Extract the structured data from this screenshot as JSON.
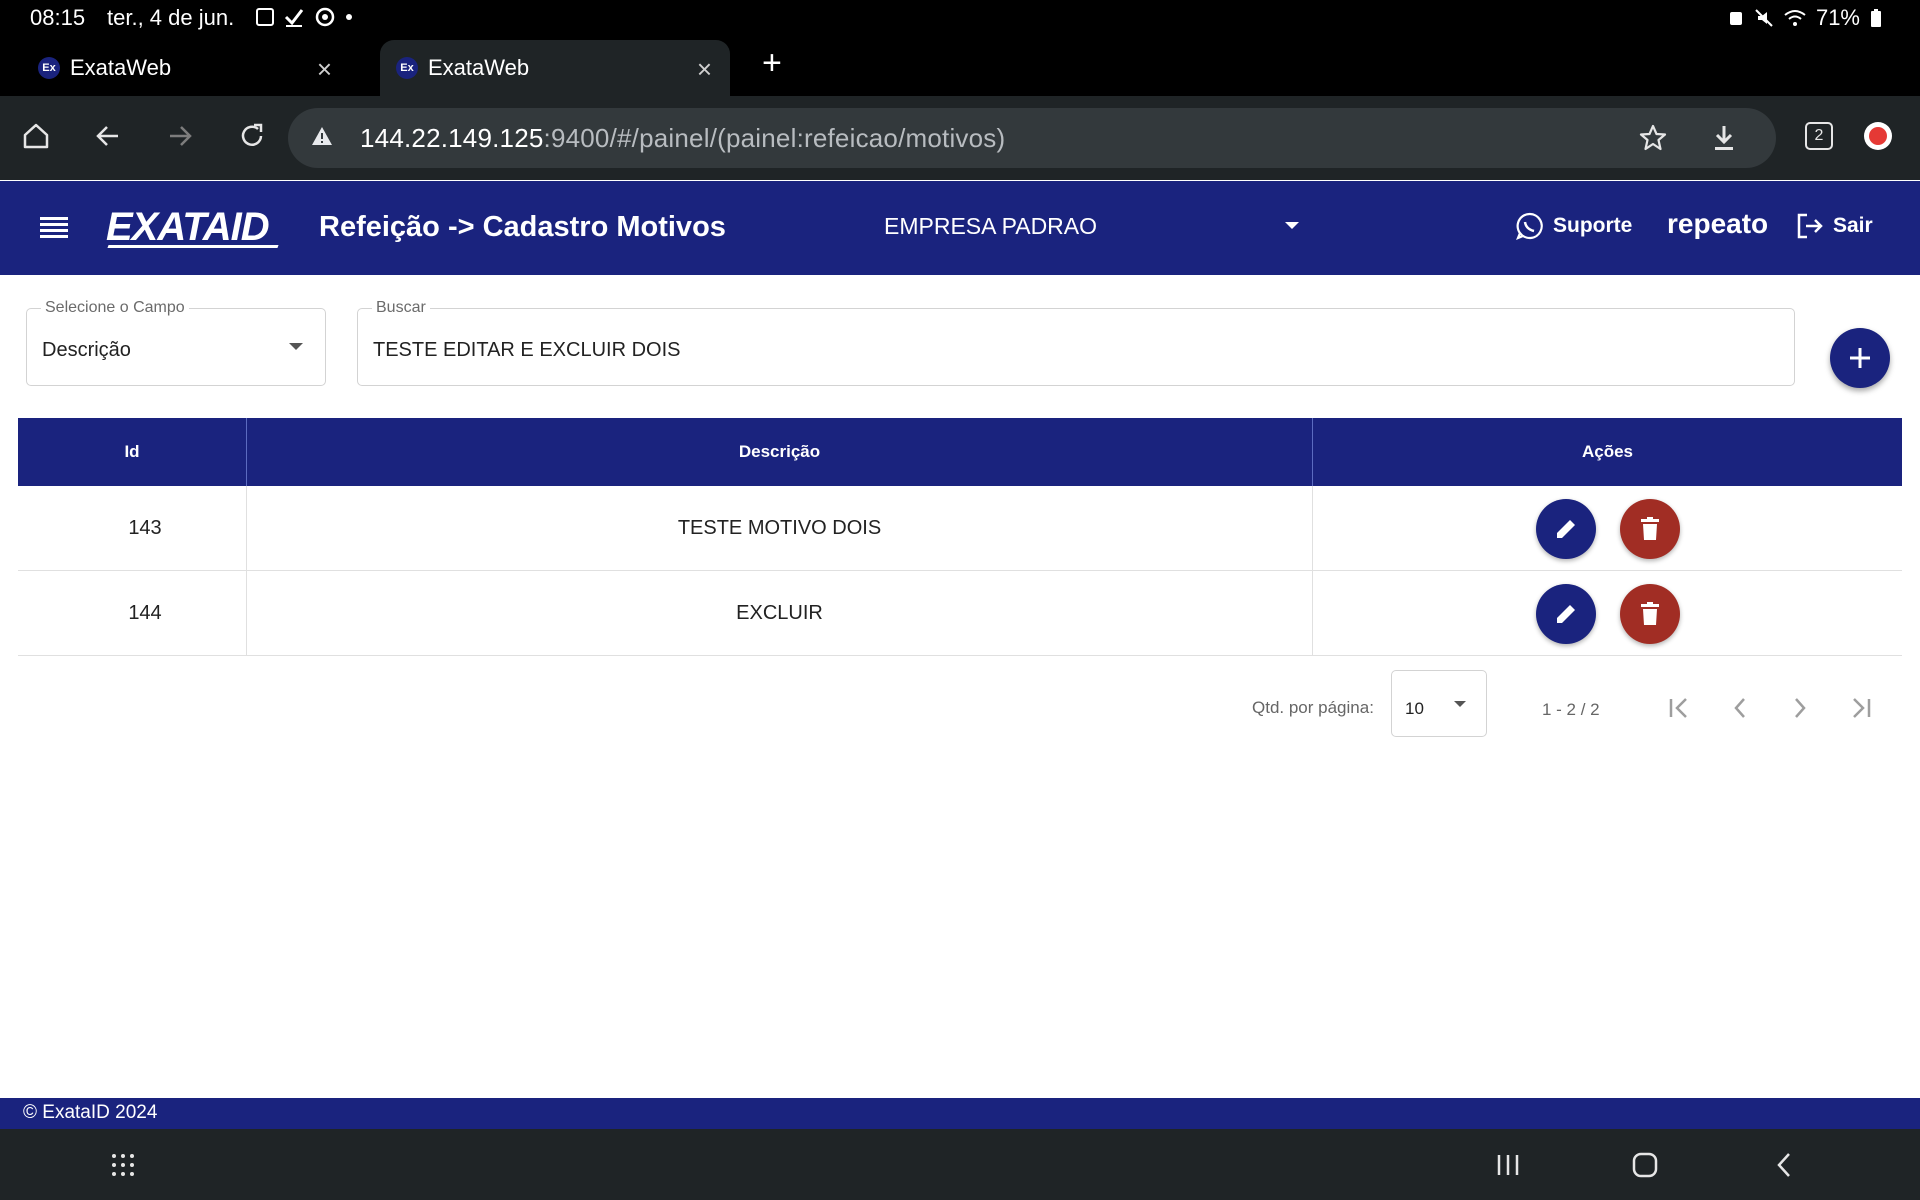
{
  "status_bar": {
    "time": "08:15",
    "date": "ter., 4 de jun.",
    "battery": "71%"
  },
  "browser": {
    "tabs": [
      {
        "title": "ExataWeb",
        "favicon": "Ex",
        "active": false
      },
      {
        "title": "ExataWeb",
        "favicon": "Ex",
        "active": true
      }
    ],
    "url_host": "144.22.149.125",
    "url_path": ":9400/#/painel/(painel:refeicao/motivos)",
    "tab_count": "2"
  },
  "header": {
    "logo_text": "EXATA",
    "logo_suffix": "ID",
    "title": "Refeição -> Cadastro Motivos",
    "company": "EMPRESA PADRAO",
    "support_label": "Suporte",
    "username": "repeato",
    "logout_label": "Sair"
  },
  "filters": {
    "field_label": "Selecione o Campo",
    "field_value": "Descrição",
    "search_label": "Buscar",
    "search_value": "TESTE EDITAR E EXCLUIR DOIS"
  },
  "table": {
    "columns": [
      "Id",
      "Descrição",
      "Ações"
    ],
    "rows": [
      {
        "id": "143",
        "descricao": "TESTE MOTIVO DOIS"
      },
      {
        "id": "144",
        "descricao": "EXCLUIR"
      }
    ]
  },
  "paginator": {
    "per_page_label": "Qtd. por página:",
    "per_page_value": "10",
    "range": "1 - 2 / 2"
  },
  "footer": {
    "copyright": "© ExataID 2024"
  },
  "colors": {
    "primary": "#1a237e",
    "danger": "#a12d24",
    "browser_chrome": "#1f2426"
  }
}
